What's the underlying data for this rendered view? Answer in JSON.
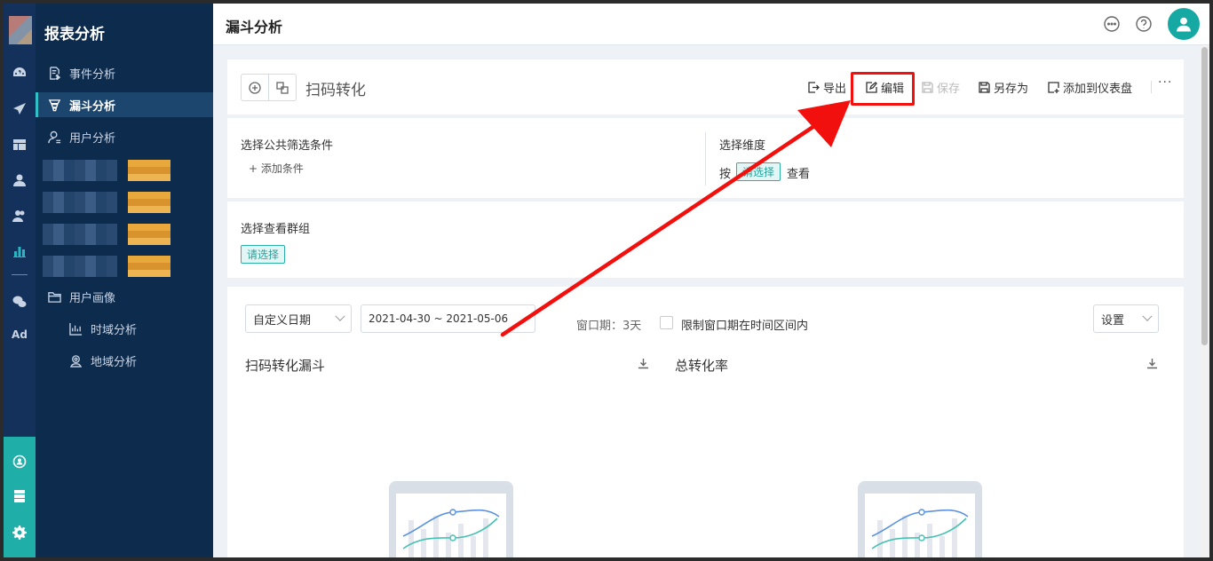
{
  "colors": {
    "accent": "#20aea9",
    "sidebar": "#0d2b4d",
    "highlight": "#f2100e"
  },
  "rail": {
    "icons": [
      "dashboard-icon",
      "send-icon",
      "layout-icon",
      "user-icon",
      "users-icon",
      "bar-chart-icon",
      "wechat-icon"
    ],
    "ad_label": "Ad",
    "bottom_icons": [
      "team-icon",
      "server-icon",
      "gear-icon"
    ]
  },
  "sidebar": {
    "title": "报表分析",
    "items": [
      {
        "label": "事件分析",
        "icon": "edit-note-icon"
      },
      {
        "label": "漏斗分析",
        "icon": "funnel-icon",
        "active": true
      },
      {
        "label": "用户分析",
        "icon": "user-outline-icon"
      },
      {
        "label": "用户画像",
        "icon": "folder-icon"
      },
      {
        "label": "时域分析",
        "icon": "bar-chart-icon"
      },
      {
        "label": "地域分析",
        "icon": "location-icon"
      }
    ]
  },
  "header": {
    "title": "漏斗分析",
    "icons": [
      "chat-icon",
      "help-icon",
      "avatar-icon"
    ]
  },
  "toolbar": {
    "report_name": "扫码转化",
    "export_label": "导出",
    "edit_label": "编辑",
    "save_label": "保存",
    "save_as_label": "另存为",
    "add_dashboard_label": "添加到仪表盘",
    "more_label": "···"
  },
  "filters": {
    "common_filter_label": "选择公共筛选条件",
    "add_condition_label": "+ 添加条件",
    "dimension_label": "选择维度",
    "dimension_prefix": "按",
    "dimension_tag": "请选择",
    "dimension_suffix": "查看"
  },
  "group": {
    "label": "选择查看群组",
    "tag": "请选择"
  },
  "controls": {
    "date_mode": "自定义日期",
    "date_range": "2021-04-30 ~ 2021-05-06",
    "window_text": "窗口期：3天",
    "limit_window_label": "限制窗口期在时间区间内",
    "settings_label": "设置"
  },
  "charts": {
    "funnel_title": "扫码转化漏斗",
    "total_rate_title": "总转化率"
  }
}
